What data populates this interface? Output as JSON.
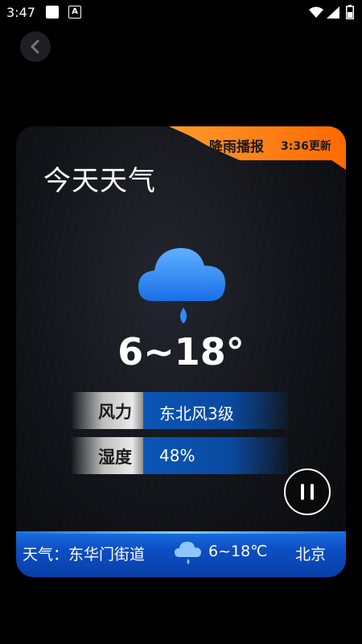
{
  "status_bar": {
    "time": "3:47"
  },
  "header": {
    "back_icon": "chevron-left-icon"
  },
  "ribbon": {
    "title": "降雨播报",
    "update": "3:36更新"
  },
  "weather": {
    "title": "今天天气",
    "icon": "rain-cloud-icon",
    "temp_range": "6~18°"
  },
  "info": [
    {
      "label": "风力",
      "value": "东北风3级"
    },
    {
      "label": "湿度",
      "value": "48%"
    }
  ],
  "controls": {
    "pause_icon": "pause-icon"
  },
  "ticker": {
    "weather_location": "天气：东华门街道",
    "temp": "6~18℃",
    "city": "北京"
  },
  "colors": {
    "ribbon": "#ff7c12",
    "ticker": "#0c4ec4",
    "wind_value_bg": "#0b55b6"
  }
}
